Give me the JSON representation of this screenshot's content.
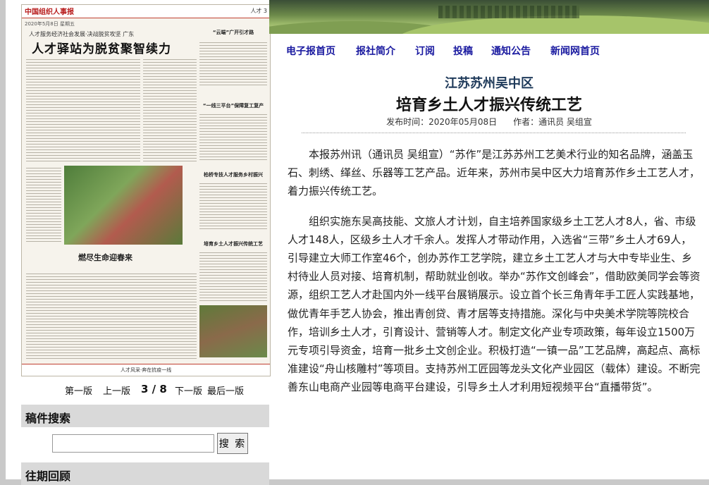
{
  "newspaper": {
    "logo_text": "中国组织人事报",
    "page_label": "人才 3",
    "date_line": "2020年5月8日 星期五",
    "kicker": "人才服务经济社会发展·决战脱贫攻坚",
    "region": "广东",
    "headline": "人才驿站为脱贫聚智续力",
    "side_title_1": "“云端”广开引才路",
    "side_title_2": "“一线三平台”保障复工复产",
    "side_title_3": "柏桥专技人才服务乡村振兴",
    "side_title_4": "培育乡土人才振兴传统工艺",
    "feature_title": "燃尽生命迎春来",
    "bottom_text": "人才风采·奔在抗疫一线"
  },
  "pager": {
    "first": "第一版",
    "prev": "上一版",
    "current": "3 / 8",
    "next": "下一版",
    "last": "最后一版"
  },
  "search": {
    "heading": "稿件搜索",
    "placeholder": "",
    "button": "搜 索"
  },
  "archive": {
    "heading": "往期回顾"
  },
  "nav": [
    "电子报首页",
    "报社简介",
    "订阅",
    "投稿",
    "通知公告",
    "新闻网首页"
  ],
  "article": {
    "subtitle": "江苏苏州吴中区",
    "title": "培育乡土人才振兴传统工艺",
    "publish_label": "发布时间：",
    "publish_date": "2020年05月08日",
    "author_label": "作者：",
    "author": "通讯员 吴组宣",
    "paragraphs": [
      "本报苏州讯（通讯员 吴组宣）“苏作”是江苏苏州工艺美术行业的知名品牌，涵盖玉石、刺绣、缂丝、乐器等工艺产品。近年来，苏州市吴中区大力培育苏作乡土工艺人才，着力振兴传统工艺。",
      "组织实施东吴高技能、文旅人才计划，自主培养国家级乡土工艺人才8人，省、市级人才148人，区级乡土人才千余人。发挥人才带动作用，入选省“三带”乡土人才69人，引导建立大师工作室46个，创办苏作工艺学院，建立乡土工艺人才与大中专毕业生、乡村待业人员对接、培育机制，帮助就业创收。举办“苏作文创峰会”，借助欧美同学会等资源，组织工艺人才赴国内外一线平台展销展示。设立首个长三角青年手工匠人实践基地，做优青年手艺人协会，推出青创贷、青才居等支持措施。深化与中央美术学院等院校合作，培训乡土人才，引育设计、营销等人才。制定文化产业专项政策，每年设立1500万元专项引导资金，培育一批乡土文创企业。积极打造“一镇一品”工艺品牌，高起点、高标准建设“舟山核雕村”等项目。支持苏州工匠园等龙头文化产业园区（载体）建设。不断完善东山电商产业园等电商平台建设，引导乡土人才利用短视频平台“直播带货”。"
    ]
  }
}
